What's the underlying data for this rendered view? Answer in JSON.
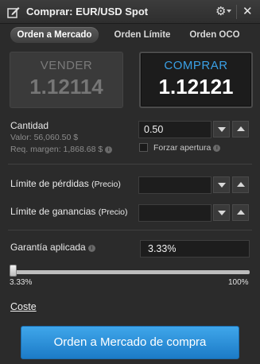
{
  "window": {
    "title": "Comprar: EUR/USD Spot",
    "icons": {
      "app": "edit-order-icon",
      "settings": "gear-icon",
      "close": "close-icon"
    }
  },
  "tabs": [
    {
      "label": "Orden a Mercado",
      "active": true
    },
    {
      "label": "Orden Límite",
      "active": false
    },
    {
      "label": "Orden OCO",
      "active": false
    }
  ],
  "prices": {
    "sell": {
      "label": "VENDER",
      "value": "1.12114"
    },
    "buy": {
      "label": "COMPRAR",
      "value": "1.12121"
    }
  },
  "quantity": {
    "label": "Cantidad",
    "value_text": "Valor: 56,060.50 $",
    "margin_text": "Req. margen: 1,868.68 $",
    "input_value": "0.50",
    "force_open_label": "Forzar apertura",
    "force_open_checked": false
  },
  "stop_loss": {
    "label": "Límite de pérdidas",
    "suffix": "(Precio)",
    "value": ""
  },
  "take_profit": {
    "label": "Límite de ganancias",
    "suffix": "(Precio)",
    "value": ""
  },
  "guarantee": {
    "label": "Garantía aplicada",
    "value": "3.33%",
    "slider_min_label": "3.33%",
    "slider_max_label": "100%",
    "slider_level": 0
  },
  "cost_link": "Coste",
  "submit_button": "Orden a Mercado de compra",
  "colors": {
    "accent": "#2a8fdb",
    "buy_label": "#3aa0e6",
    "background": "#2b2b2b"
  }
}
